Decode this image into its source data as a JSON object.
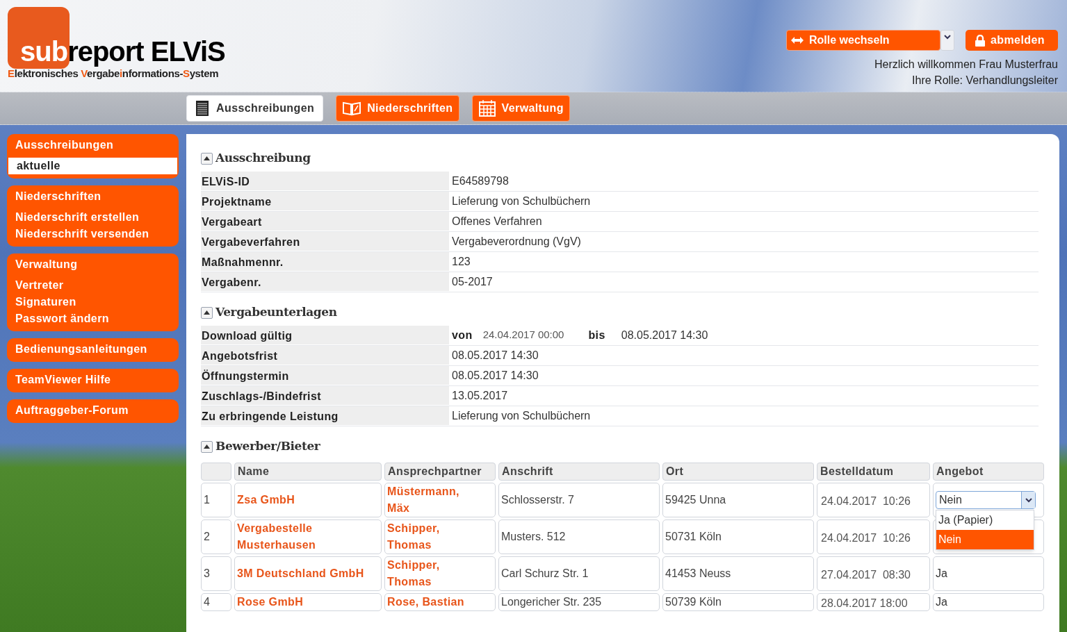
{
  "logo": {
    "mark": "sub",
    "name": "report ELViS",
    "tagline": [
      {
        "text": "E",
        "accent": true
      },
      {
        "text": "lektronisches ",
        "accent": false
      },
      {
        "text": "V",
        "accent": true
      },
      {
        "text": "ergabe",
        "accent": false
      },
      {
        "text": "i",
        "accent": true
      },
      {
        "text": "nformations-",
        "accent": false
      },
      {
        "text": "S",
        "accent": true
      },
      {
        "text": "ystem",
        "accent": false
      }
    ]
  },
  "header": {
    "role_button": "Rolle wechseln",
    "logout_button": "abmelden",
    "welcome": "Herzlich willkommen Frau Musterfrau",
    "role": "Ihre Rolle: Verhandlungsleiter"
  },
  "nav_tabs": [
    {
      "label": "Ausschreibungen",
      "selected": true
    },
    {
      "label": "Niederschriften",
      "selected": false
    },
    {
      "label": "Verwaltung",
      "selected": false
    }
  ],
  "sidebar": [
    {
      "title": "Ausschreibungen",
      "items": [
        {
          "label": "aktuelle",
          "selected": true
        }
      ]
    },
    {
      "title": "Niederschriften",
      "items": [
        {
          "label": "Niederschrift erstellen",
          "selected": false
        },
        {
          "label": "Niederschrift versenden",
          "selected": false
        }
      ]
    },
    {
      "title": "Verwaltung",
      "items": [
        {
          "label": "Vertreter",
          "selected": false
        },
        {
          "label": "Signaturen",
          "selected": false
        },
        {
          "label": "Passwort ändern",
          "selected": false
        }
      ]
    },
    {
      "title": "Bedienungsanleitungen"
    },
    {
      "title": "TeamViewer Hilfe"
    },
    {
      "title": "Auftraggeber-Forum"
    }
  ],
  "sections": [
    {
      "title": "Ausschreibung",
      "expanded": true,
      "kind": "fields",
      "fields": [
        {
          "label": "ELViS-ID",
          "value": "E64589798"
        },
        {
          "label": "Projektname",
          "value": "Lieferung von Schulbüchern"
        },
        {
          "label": "Vergabeart",
          "value": "Offenes Verfahren"
        },
        {
          "label": "Vergabeverfahren",
          "value": "Vergabeverordnung (VgV)"
        },
        {
          "label": "Maßnahmennr.",
          "value": "123"
        },
        {
          "label": "Vergabenr.",
          "value": "05-2017"
        }
      ]
    },
    {
      "title": "Vergabeunterlagen",
      "expanded": true,
      "kind": "fields",
      "fields": [
        {
          "label": "Download gültig",
          "kind": "range",
          "from_label": "von",
          "from": "24.04.2017 00:00",
          "to_label": "bis",
          "to": "08.05.2017 14:30"
        },
        {
          "label": "Angebotsfrist",
          "value": "08.05.2017 14:30"
        },
        {
          "label": "Öffnungstermin",
          "value": "08.05.2017 14:30"
        },
        {
          "label": "Zuschlags-/Bindefrist",
          "value": "13.05.2017"
        },
        {
          "label": "Zu erbringende Leistung",
          "value": "Lieferung von Schulbüchern"
        }
      ]
    },
    {
      "title": "Bewerber/Bieter",
      "expanded": true,
      "kind": "table",
      "columns": [
        "Name",
        "Ansprechpartner",
        "Anschrift",
        "Ort",
        "Bestelldatum",
        "Angebot"
      ],
      "rows": [
        {
          "nr": "1",
          "name": "Zsa GmbH",
          "contact": "Müstermann, Mäx",
          "address": "Schlosserstr. 7",
          "city": "59425 Unna",
          "date": "24.04.2017  10:26",
          "offer": {
            "kind": "select",
            "value": "Nein",
            "expanded": true,
            "options": [
              {
                "label": "Ja (Papier)",
                "selected": false
              },
              {
                "label": "Nein",
                "selected": true
              }
            ]
          }
        },
        {
          "nr": "2",
          "name": "Vergabestelle Musterhausen",
          "contact": "Schipper, Thomas",
          "address": "Musters. 512",
          "city": "50731 Köln",
          "date": "24.04.2017  10:26"
        },
        {
          "nr": "3",
          "name": "3M Deutschland GmbH",
          "contact": "Schipper, Thomas",
          "address": "Carl Schurz Str. 1",
          "city": "41453 Neuss",
          "date": "27.04.2017  08:30",
          "offer": {
            "kind": "text",
            "value": "Ja"
          }
        },
        {
          "nr": "4",
          "name": "Rose GmbH",
          "contact": "Rose, Bastian",
          "address": "Longericher Str. 235",
          "city": "50739 Köln",
          "date": "28.04.2017 18:00",
          "offer": {
            "kind": "text",
            "value": "Ja"
          }
        }
      ]
    }
  ]
}
